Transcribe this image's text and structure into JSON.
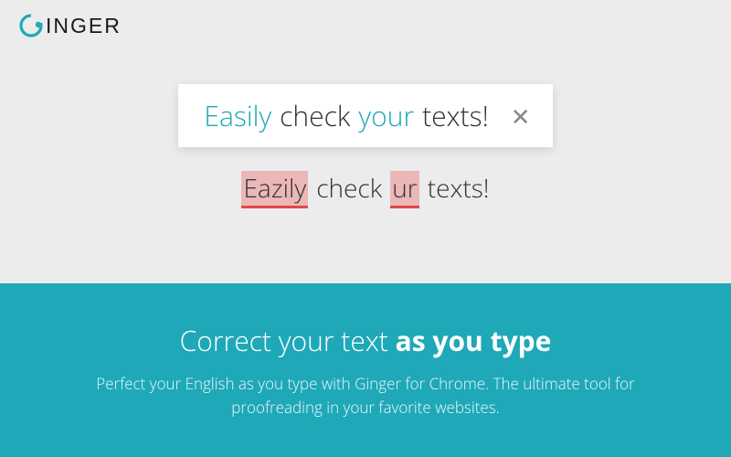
{
  "logo": {
    "brand_text": "INGER"
  },
  "correction": {
    "word1": "Easily",
    "word2": "check",
    "word3": "your",
    "word4": "texts!"
  },
  "error_line": {
    "word1": "Eazily",
    "word2": "check",
    "word3": "ur",
    "word4": "texts!"
  },
  "promo": {
    "headline_normal": "Correct your text ",
    "headline_bold": "as you type",
    "subtext": "Perfect your English as you type with Ginger for Chrome. The ultimate tool for proofreading in your favorite websites."
  },
  "colors": {
    "accent": "#1fa8b8",
    "error_bg": "rgba(236,120,120,0.45)",
    "error_underline": "#e04848"
  }
}
